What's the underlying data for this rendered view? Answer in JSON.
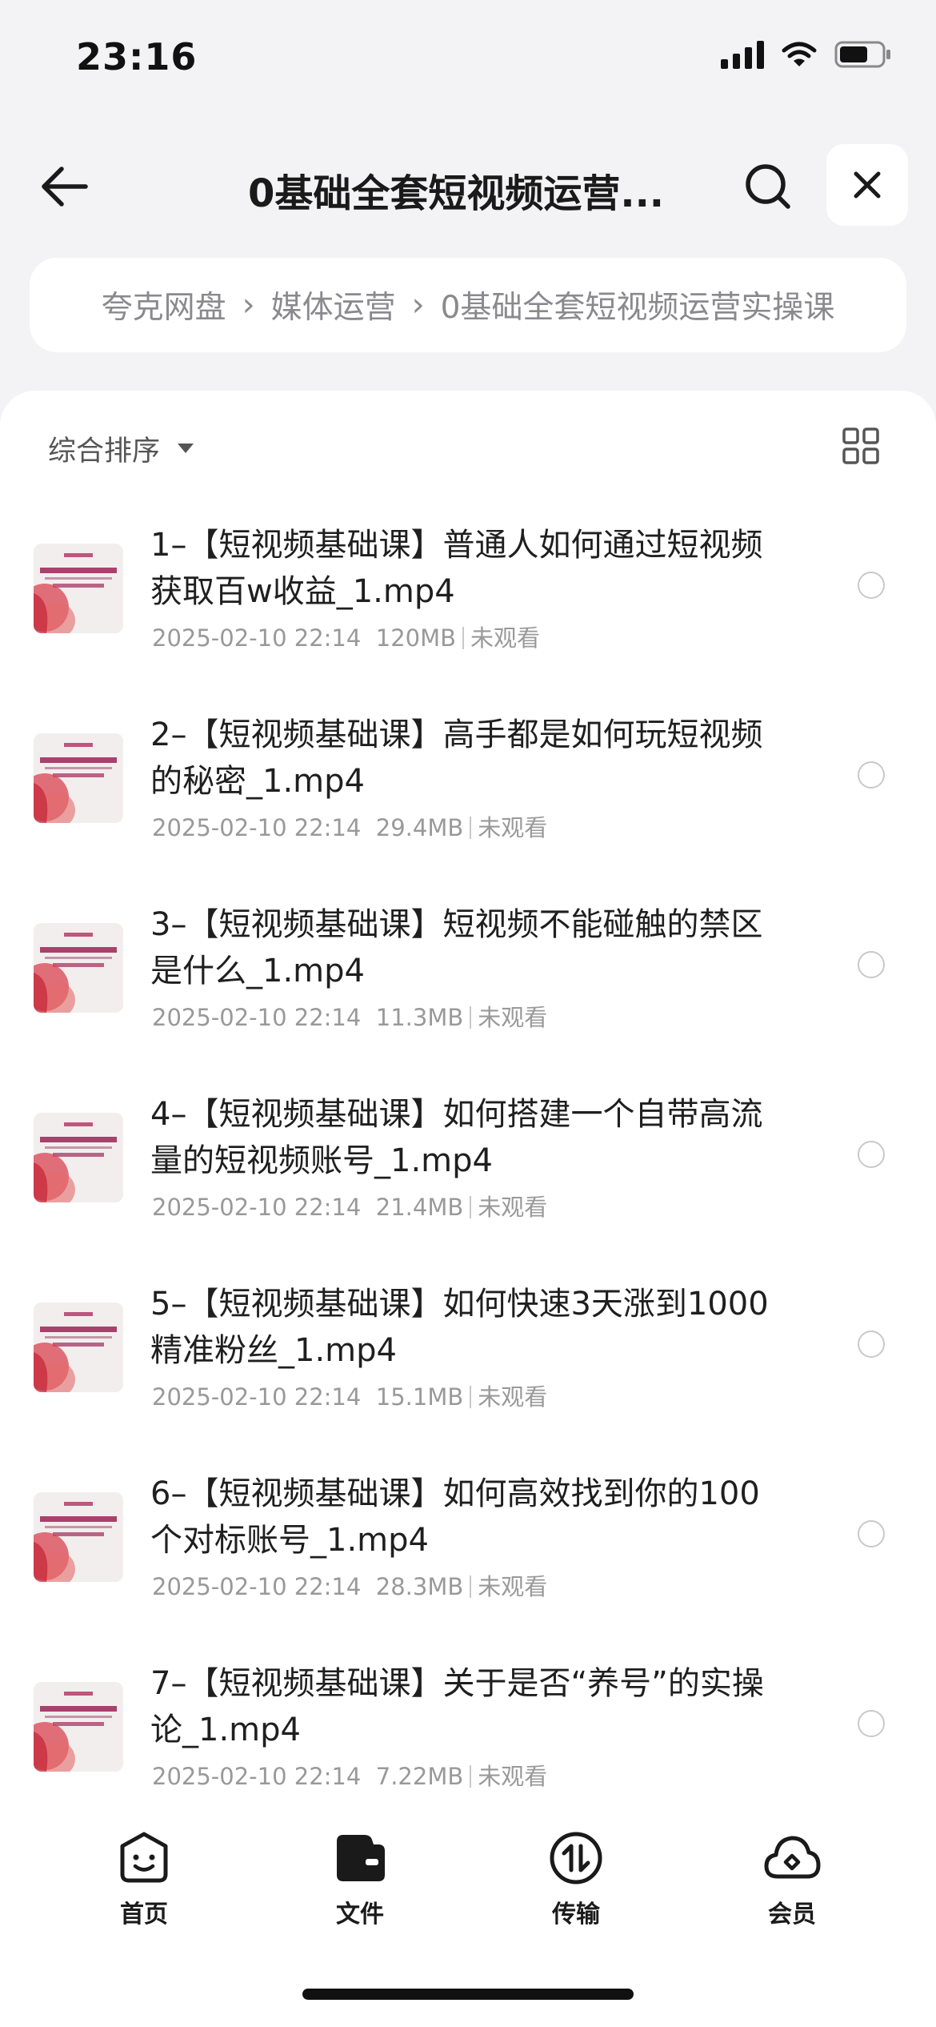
{
  "status_bar": {
    "time": "23:16",
    "icons": [
      "signal-icon",
      "wifi-icon",
      "battery-icon"
    ]
  },
  "header": {
    "title": "0基础全套短视频运营...",
    "back_icon": "arrow-left-icon",
    "search_icon": "search-icon",
    "close_icon": "close-icon"
  },
  "breadcrumb": {
    "items": [
      "夸克网盘",
      "媒体运营",
      "0基础全套短视频运营实操课"
    ],
    "separator": "›"
  },
  "toolbar": {
    "sort_label": "综合排序",
    "sort_icon": "caret-down-icon",
    "view_icon": "grid-view-icon"
  },
  "files": [
    {
      "name": "1–【短视频基础课】普通人如何通过短视频获取百w收益_1.mp4",
      "date": "2025-02-10 22:14",
      "size": "120MB",
      "status": "未观看"
    },
    {
      "name": "2–【短视频基础课】高手都是如何玩短视频的秘密_1.mp4",
      "date": "2025-02-10 22:14",
      "size": "29.4MB",
      "status": "未观看"
    },
    {
      "name": "3–【短视频基础课】短视频不能碰触的禁区是什么_1.mp4",
      "date": "2025-02-10 22:14",
      "size": "11.3MB",
      "status": "未观看"
    },
    {
      "name": "4–【短视频基础课】如何搭建一个自带高流量的短视频账号_1.mp4",
      "date": "2025-02-10 22:14",
      "size": "21.4MB",
      "status": "未观看"
    },
    {
      "name": "5–【短视频基础课】如何快速3天涨到1000精准粉丝_1.mp4",
      "date": "2025-02-10 22:14",
      "size": "15.1MB",
      "status": "未观看"
    },
    {
      "name": "6–【短视频基础课】如何高效找到你的100个对标账号_1.mp4",
      "date": "2025-02-10 22:14",
      "size": "28.3MB",
      "status": "未观看"
    },
    {
      "name": "7–【短视频基础课】关于是否“养号”的实操论_1.mp4",
      "date": "2025-02-10 22:14",
      "size": "7.22MB",
      "status": "未观看"
    }
  ],
  "tab_bar": {
    "tabs": [
      {
        "label": "首页",
        "icon": "smile-face-icon"
      },
      {
        "label": "文件",
        "icon": "folder-icon"
      },
      {
        "label": "传输",
        "icon": "transfer-icon"
      },
      {
        "label": "会员",
        "icon": "cloud-icon"
      }
    ],
    "active": "文件"
  },
  "colors": {
    "background": "#f3f3f5",
    "panel": "#ffffff",
    "text_primary": "#1f1f1f",
    "text_secondary": "#999999"
  }
}
